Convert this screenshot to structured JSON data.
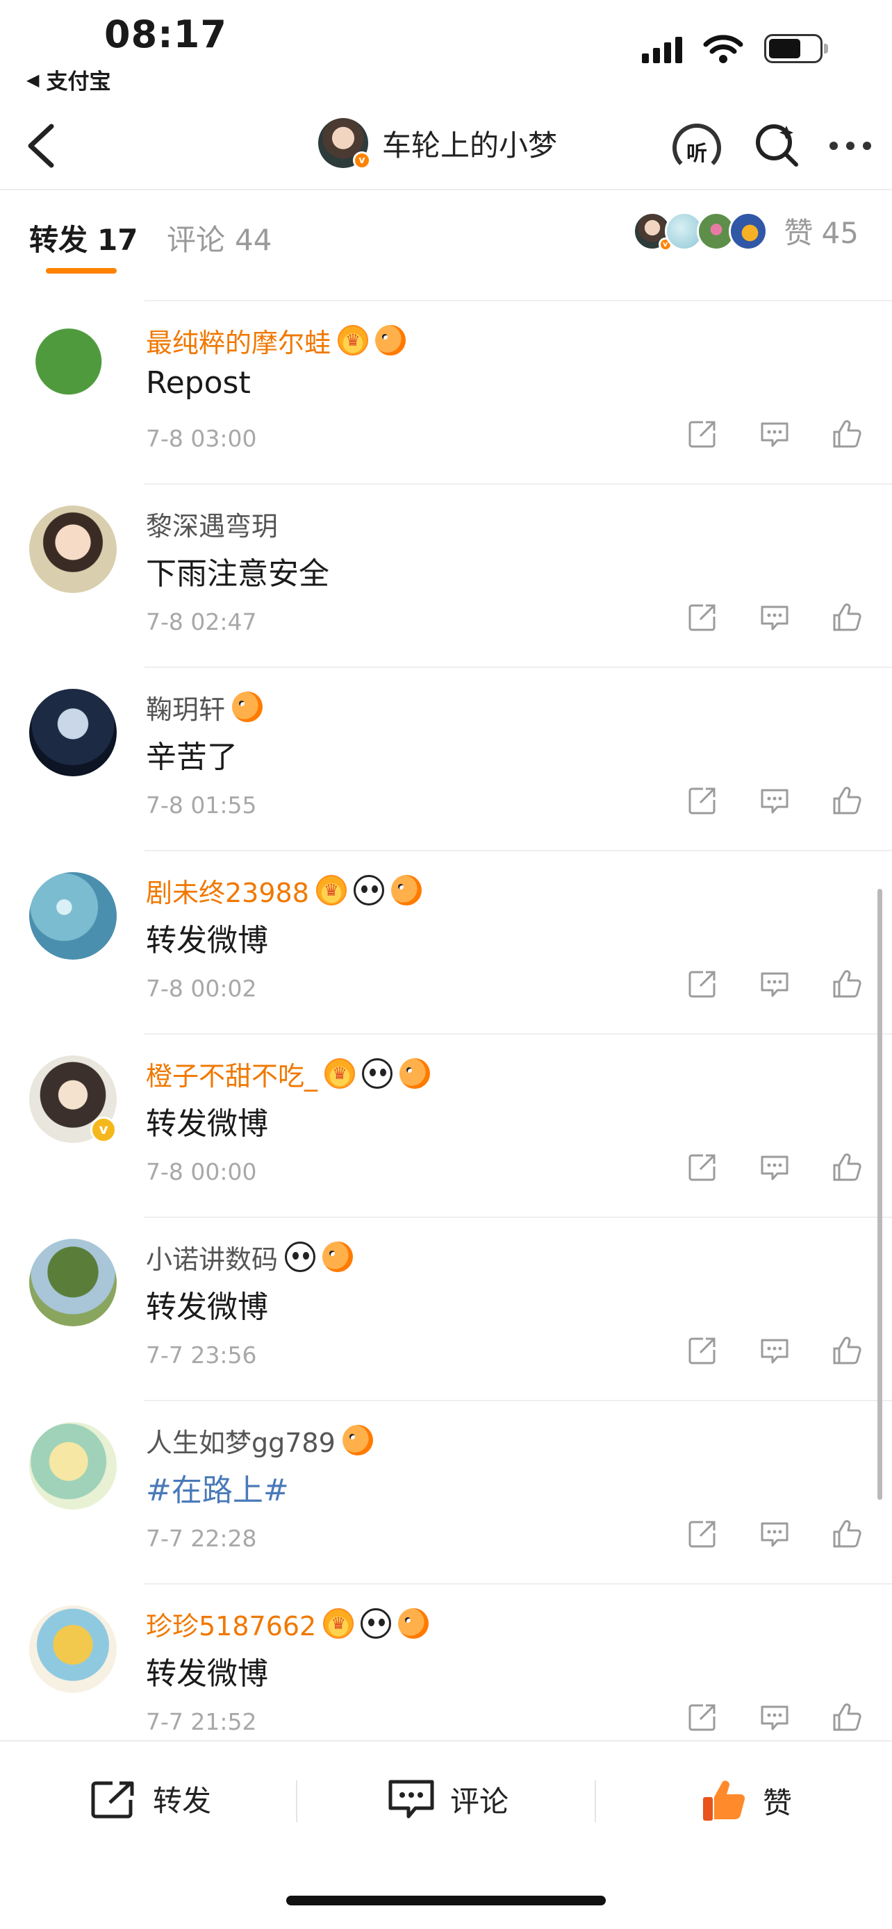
{
  "status_bar": {
    "time": "08:17",
    "back_app": "支付宝"
  },
  "nav": {
    "title": "车轮上的小梦",
    "listen_label": "听"
  },
  "tabs": {
    "repost_label": "转发",
    "repost_count": "17",
    "comment_label": "评论",
    "comment_count": "44",
    "like_label": "赞",
    "like_count": "45"
  },
  "reposts": [
    {
      "name": "最纯粹的摩尔蛙",
      "text": "Repost",
      "time": "7-8 03:00"
    },
    {
      "name": "黎深遇弯玥",
      "text": "下雨注意安全",
      "time": "7-8 02:47"
    },
    {
      "name": "鞠玥轩",
      "text": "辛苦了",
      "time": "7-8 01:55"
    },
    {
      "name": "剧未终23988",
      "text": "转发微博",
      "time": "7-8 00:02"
    },
    {
      "name": "橙子不甜不吃_",
      "text": "转发微博",
      "time": "7-8 00:00"
    },
    {
      "name": "小诺讲数码",
      "text": "转发微博",
      "time": "7-7 23:56"
    },
    {
      "name": "人生如梦gg789",
      "text": "#在路上#",
      "time": "7-7 22:28"
    },
    {
      "name": "珍珍5187662",
      "text": "转发微博",
      "time": "7-7 21:52"
    }
  ],
  "bottom_bar": {
    "repost": "转发",
    "comment": "评论",
    "like": "赞"
  },
  "colors": {
    "accent": "#ff8200",
    "vip_name": "#f07800",
    "topic_link": "#4a7ab8",
    "muted": "#a8a8a8"
  }
}
